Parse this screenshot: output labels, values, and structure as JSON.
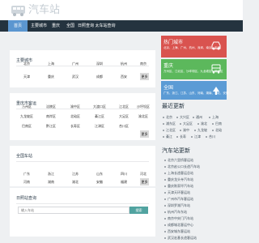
{
  "site": {
    "name": "汽车站"
  },
  "nav": [
    "首页",
    "主要城市",
    "重庆",
    "全国",
    "日照查询",
    "太车站查询"
  ],
  "main_cities": {
    "title": "主要城市",
    "cities": [
      "北京",
      "上海",
      "广州",
      "深圳",
      "杭州",
      "南京",
      "天津",
      "重庆",
      "武汉",
      "成都",
      "西安"
    ],
    "more": "更多"
  },
  "chongqing": {
    "title": "重庆市客运",
    "cities": [
      "万州区",
      "涪陵区",
      "渝中区",
      "大渡口区",
      "江北区",
      "沙坪坝区",
      "九龙坡区",
      "南岸区",
      "北碚区",
      "綦江区",
      "大足区",
      "渝北区",
      "巴南区",
      "黔江区",
      "长寿区",
      "江津区",
      "合川区"
    ],
    "more": "更多"
  },
  "national": {
    "title": "全国车站",
    "cities": [
      "广东",
      "浙江",
      "江苏",
      "山东",
      "四川",
      "河北",
      "河南",
      "湖南",
      "湖北",
      "安徽",
      "福建"
    ],
    "more": "更多"
  },
  "search": {
    "title": "日照站查询",
    "placeholder": "输入车站",
    "button": "搜索"
  },
  "side_cards": [
    {
      "title": "热门城市",
      "sub": "北京、上海、广州、杭州、深圳、南京、天津",
      "color": "#d9534f"
    },
    {
      "title": "重庆",
      "sub": "万州区、江北区、沙坪坝区、九龙坡区、渝北区",
      "color": "#5cb85c"
    },
    {
      "title": "全国",
      "sub": "广东、浙江、江苏、山东、河南、湖南、湖北、安徽",
      "color": "#5b9bd5"
    }
  ],
  "latest": {
    "title": "最近更新",
    "items": [
      "北京",
      "大兴区",
      "通州",
      "上海",
      "浦东区",
      "大足区",
      "渝北",
      "巴南",
      "江北区",
      "渝中",
      "九龙坡",
      "北碚",
      "綦江",
      "长寿",
      "江津",
      "合川"
    ]
  },
  "news": {
    "title": "汽车站更新",
    "items": [
      "北京六里桥客运站",
      "北京赵公口长途汽车站",
      "上海长途客运总站",
      "重庆龙头寺汽车站",
      "重庆陈家坪汽车站",
      "天津天环客运站",
      "广州市汽车客运站",
      "深圳罗湖汽车站",
      "杭州汽车东站",
      "南京中央门汽车站",
      "成都城北客运中心",
      "西安城东客运站",
      "武汉宏基长途客运站"
    ]
  }
}
